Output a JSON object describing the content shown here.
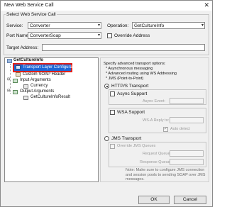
{
  "window": {
    "title": "New Web Service Call",
    "close_glyph": "✕"
  },
  "group": {
    "label": "Select Web Service Call"
  },
  "service": {
    "label": "Service:",
    "value": "Converter"
  },
  "port_name": {
    "label": "Port Name:",
    "value": "ConverterSoap"
  },
  "operation": {
    "label": "Operation:",
    "value": "GetCultureInfo"
  },
  "override_address": {
    "label": "Override Address"
  },
  "target_address": {
    "label": "Target Address:",
    "value": ""
  },
  "tree": {
    "root": "GetCultureInfo",
    "selected": "Transport Layer Configuration",
    "custom_header": "Custom SOAP Header",
    "input_args": "Input Arguments",
    "currency": "Currency",
    "output_args": "Output Arguments",
    "result": "GetCultureInfoResult"
  },
  "transport": {
    "heading": "Specify advanced transport options:",
    "bullets": [
      "* Asynchronous messaging",
      "* Advanced routing using WS Addressing",
      "* JMS (Point-to-Point)"
    ],
    "http_label": "HTTP/S Transport",
    "async_label": "Async Support",
    "async_event_label": "Async Event:",
    "wsa_label": "WSA Support",
    "wsa_reply_label": "WS-A Reply to:",
    "auto_detect_label": "Auto detect",
    "jms_label": "JMS Transport",
    "override_jms_label": "Override JMS Queues",
    "request_queue_label": "Request Queue:",
    "response_queue_label": "Response Queue:",
    "note": "Note: Make sure to configure JMS connection and session pools to sending SOAP over JMS messages."
  },
  "buttons": {
    "ok": "OK",
    "cancel": "Cancel"
  }
}
